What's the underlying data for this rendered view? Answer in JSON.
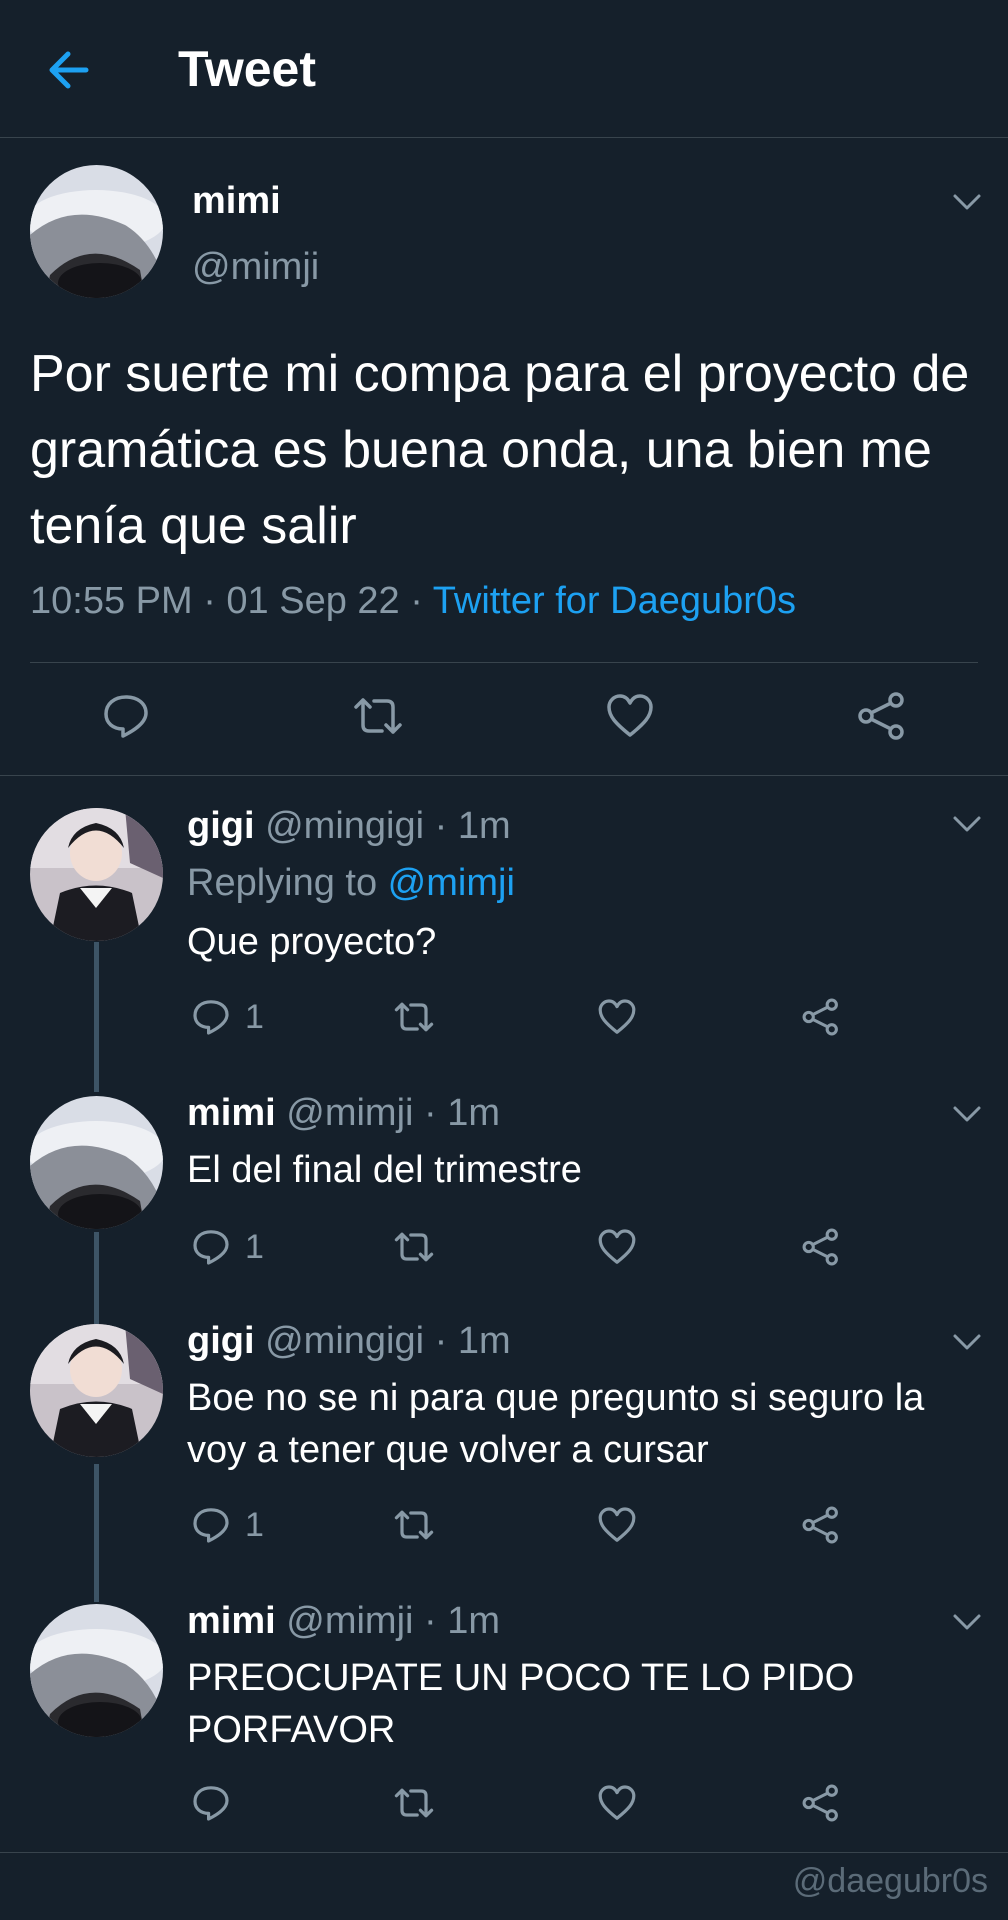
{
  "header": {
    "title": "Tweet",
    "back_icon": "arrow-left-icon"
  },
  "colors": {
    "background": "#15202b",
    "accent": "#1da1f2",
    "muted": "#8899a6",
    "divider": "#38444d"
  },
  "main_tweet": {
    "name": "mimi",
    "handle": "@mimji",
    "text": "Por suerte mi compa para el proyecto de gramática es buena onda, una bien me tenía que salir",
    "time": "10:55 PM · 01 Sep 22 · ",
    "source": "Twitter for Daegubr0s"
  },
  "replies": [
    {
      "name": "gigi",
      "meta": " @mingigi · 1m",
      "replying_label": "Replying to ",
      "replying_handle": "@mimji",
      "text": "Que proyecto?",
      "reply_count": "1"
    },
    {
      "name": "mimi",
      "meta": " @mimji · 1m",
      "text": "El del final del trimestre",
      "reply_count": "1"
    },
    {
      "name": "gigi",
      "meta": " @mingigi · 1m",
      "text": "Boe no se ni para que pregunto si seguro la voy a tener que volver a cursar",
      "reply_count": "1"
    },
    {
      "name": "mimi",
      "meta": " @mimji · 1m",
      "text": "PREOCUPATE UN POCO TE LO PIDO PORFAVOR",
      "reply_count": ""
    }
  ],
  "watermark": "@daegubr0s"
}
